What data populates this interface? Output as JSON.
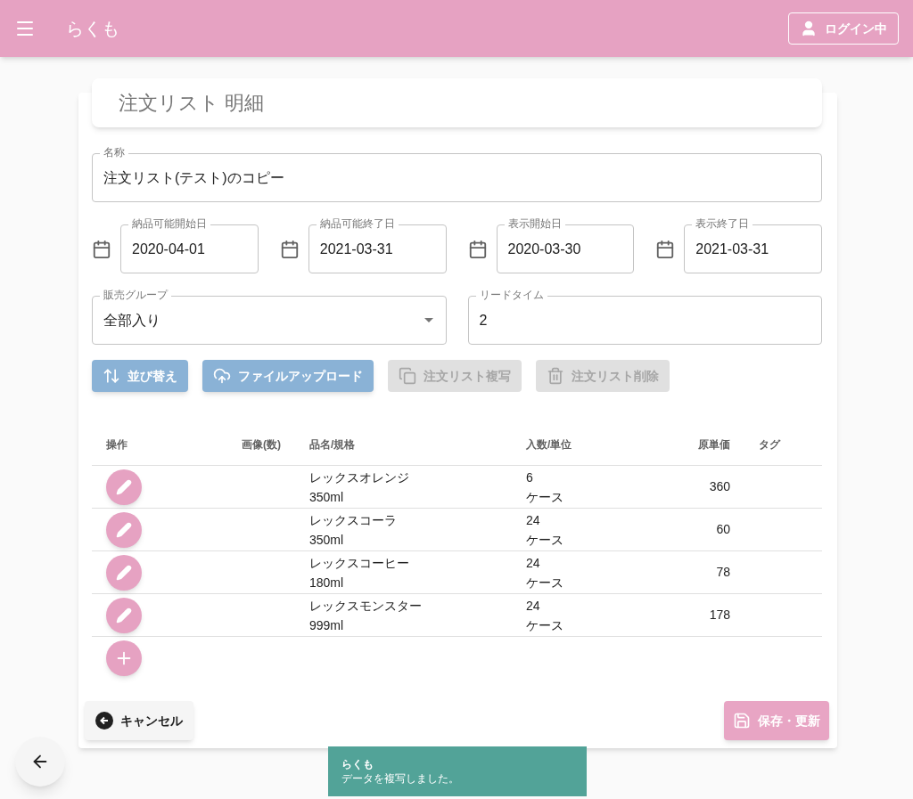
{
  "app_bar": {
    "title": "らくも",
    "login_button": "ログイン中"
  },
  "page_title": "注文リスト 明細",
  "name_field": {
    "label": "名称",
    "value": "注文リスト(テスト)のコピー"
  },
  "date_fields": [
    {
      "label": "納品可能開始日",
      "value": "2020-04-01"
    },
    {
      "label": "納品可能終了日",
      "value": "2021-03-31"
    },
    {
      "label": "表示開始日",
      "value": "2020-03-30"
    },
    {
      "label": "表示終了日",
      "value": "2021-03-31"
    }
  ],
  "sales_group": {
    "label": "販売グループ",
    "value": "全部入り"
  },
  "lead_time": {
    "label": "リードタイム",
    "value": "2"
  },
  "actions": [
    {
      "kind": "sort",
      "label": "並び替え",
      "disabled": false
    },
    {
      "kind": "upload",
      "label": "ファイルアップロード",
      "disabled": false
    },
    {
      "kind": "copy",
      "label": "注文リスト複写",
      "disabled": true
    },
    {
      "kind": "delete",
      "label": "注文リスト削除",
      "disabled": true
    }
  ],
  "table": {
    "columns": [
      "操作",
      "画像(数)",
      "品名/規格",
      "入数/単位",
      "原単価",
      "タグ"
    ],
    "rows": [
      {
        "name": "レックスオレンジ",
        "spec": "350ml",
        "quantity": "6",
        "unit": "ケース",
        "price": "360"
      },
      {
        "name": "レックスコーラ",
        "spec": "350ml",
        "quantity": "24",
        "unit": "ケース",
        "price": "60"
      },
      {
        "name": "レックスコーヒー",
        "spec": "180ml",
        "quantity": "24",
        "unit": "ケース",
        "price": "78"
      },
      {
        "name": "レックスモンスター",
        "spec": "999ml",
        "quantity": "24",
        "unit": "ケース",
        "price": "178"
      }
    ]
  },
  "cancel_button": "キャンセル",
  "save_button": "保存・更新",
  "snackbar": {
    "title": "らくも",
    "message": "データを複写しました。"
  }
}
